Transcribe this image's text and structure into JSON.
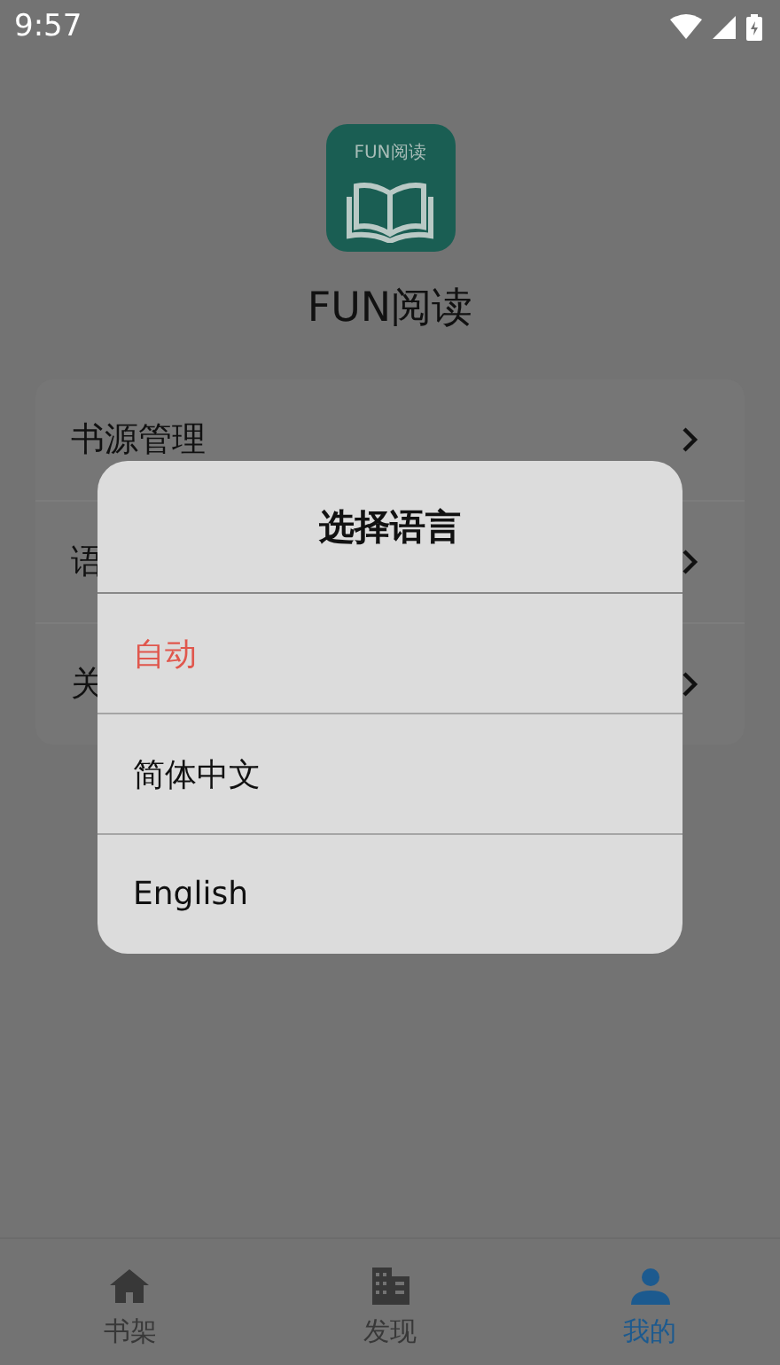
{
  "status_bar": {
    "time": "9:57"
  },
  "app": {
    "icon_label": "FUN阅读",
    "name": "FUN阅读"
  },
  "menu": [
    {
      "label": "书源管理"
    },
    {
      "label": "语"
    },
    {
      "label": "关"
    }
  ],
  "dialog": {
    "title": "选择语言",
    "options": [
      {
        "label": "自动",
        "selected": true
      },
      {
        "label": "简体中文",
        "selected": false
      },
      {
        "label": "English",
        "selected": false
      }
    ]
  },
  "bottom_nav": [
    {
      "label": "书架",
      "selected": false
    },
    {
      "label": "发现",
      "selected": false
    },
    {
      "label": "我的",
      "selected": true
    }
  ]
}
